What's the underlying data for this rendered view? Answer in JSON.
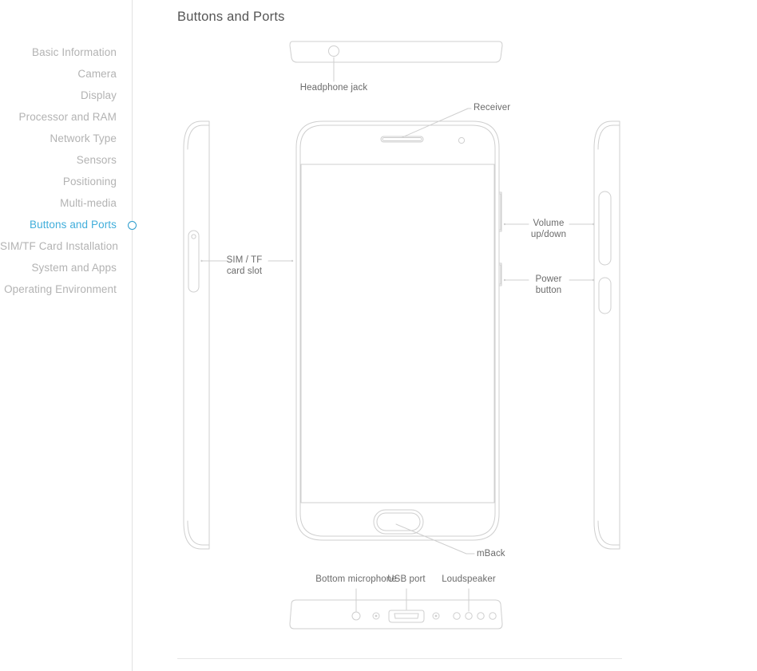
{
  "sidebar": {
    "items": [
      {
        "label": "Basic Information",
        "active": false
      },
      {
        "label": "Camera",
        "active": false
      },
      {
        "label": "Display",
        "active": false
      },
      {
        "label": "Processor and RAM",
        "active": false
      },
      {
        "label": "Network Type",
        "active": false
      },
      {
        "label": "Sensors",
        "active": false
      },
      {
        "label": "Positioning",
        "active": false
      },
      {
        "label": "Multi-media",
        "active": false
      },
      {
        "label": "Buttons and Ports",
        "active": true
      },
      {
        "label": "SIM/TF Card Installation",
        "active": false
      },
      {
        "label": "System and Apps",
        "active": false
      },
      {
        "label": "Operating Environment",
        "active": false
      }
    ],
    "active_index": 8,
    "active_color": "#41aedb",
    "inactive_color": "#b3b3b3",
    "marker_icon": "circle-marker-icon"
  },
  "header": {
    "title": "Buttons and Ports"
  },
  "diagram": {
    "line_color": "#cfcfcf",
    "label_color": "#6b6b6b",
    "callouts": {
      "headphone_jack": "Headphone jack",
      "receiver": "Receiver",
      "sim_tf_line1": "SIM / TF",
      "sim_tf_line2": "card slot",
      "volume_line1": "Volume",
      "volume_line2": "up/down",
      "power_line1": "Power",
      "power_line2": "button",
      "mback": "mBack",
      "bottom_microphone": "Bottom microphone",
      "usb_port": "USB port",
      "loudspeaker": "Loudspeaker"
    },
    "views": {
      "top_edge": "phone-top-edge-view",
      "left_profile": "phone-left-profile-view",
      "front": "phone-front-view",
      "right_profile": "phone-right-profile-view",
      "bottom_edge": "phone-bottom-edge-view"
    }
  }
}
